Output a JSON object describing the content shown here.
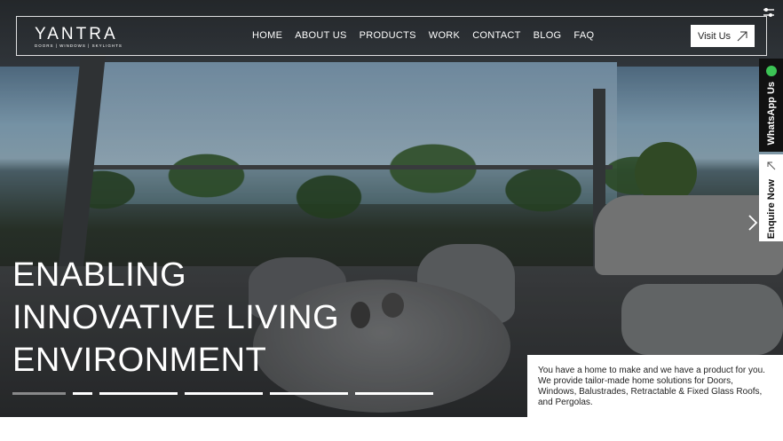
{
  "brand": {
    "name": "YANTRA",
    "tagline": "DOORS | WINDOWS | SKYLIGHTS"
  },
  "nav": {
    "items": [
      "HOME",
      "ABOUT US",
      "PRODUCTS",
      "WORK",
      "CONTACT",
      "BLOG",
      "FAQ"
    ],
    "cta": "Visit Us"
  },
  "hero": {
    "headline": [
      "ENABLING",
      "INNOVATIVE LIVING",
      "ENVIRONMENT"
    ],
    "slide_count": 6,
    "active_slide": 1
  },
  "side": {
    "whatsapp": "WhatsApp Us",
    "enquire": "Enquire Now"
  },
  "description": "You have a home to make and we have a product for you. We provide tailor-made home solutions for Doors, Windows, Balustrades, Retractable & Fixed Glass Roofs, and Pergolas.",
  "colors": {
    "whatsapp_green": "#3cc455",
    "side_dark": "#111111"
  },
  "icons": {
    "visit": "arrow-up-right-icon",
    "next": "chevron-right-icon",
    "corner": "filter-icon"
  }
}
